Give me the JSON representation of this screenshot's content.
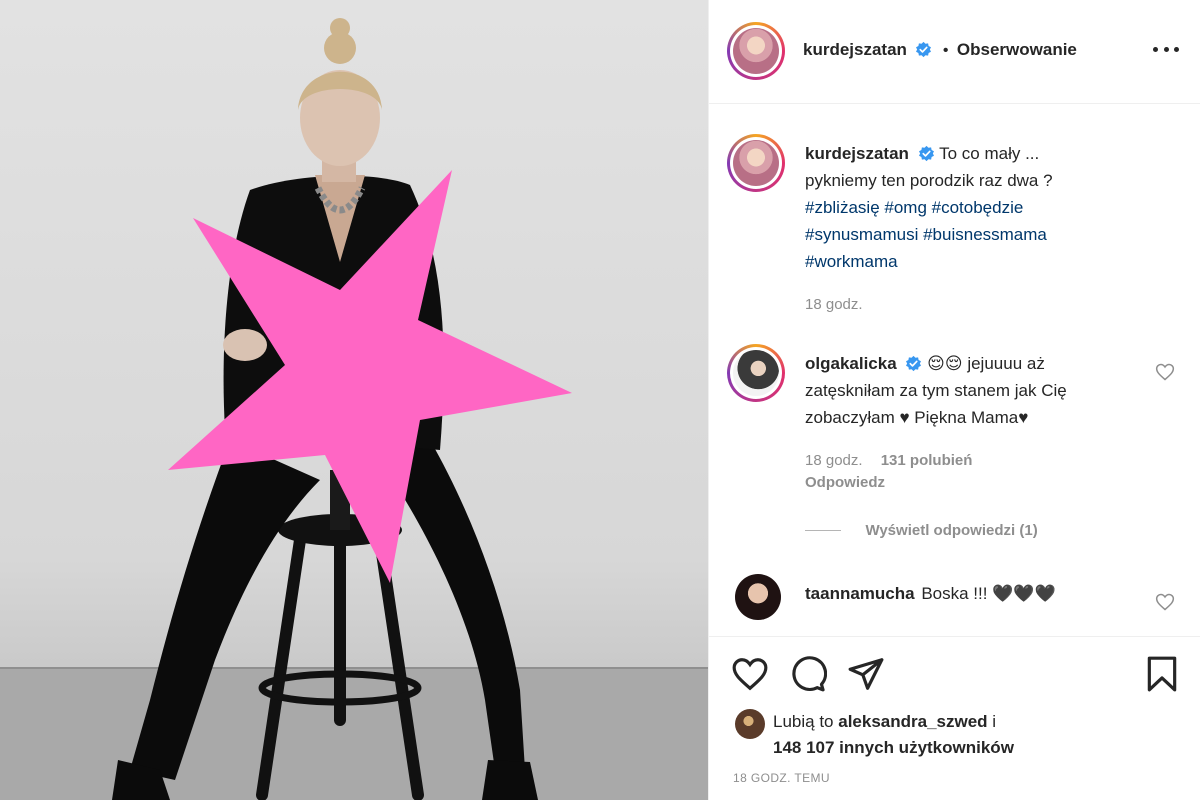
{
  "post": {
    "author": "kurdejszatan",
    "follow_label": "Obserwowanie",
    "separator": "•",
    "caption_line1": "To co mały ...",
    "caption_line2": "pykniemy ten porodzik raz dwa ?",
    "hashtags_line1": "#zbliżasię #omg #cotobędzie",
    "hashtags_line2": "#synusmamusi #buisnessmama",
    "hashtags_line3": "#workmama",
    "caption_time": "18 godz."
  },
  "comments": [
    {
      "user": "olgakalicka",
      "emoji": "😌😌",
      "line1": "jejuuuu aż",
      "line2": "zatęskniłam za tym stanem jak Cię",
      "line3": "zobaczyłam ♥ Piękna Mama♥",
      "time": "18 godz.",
      "likes": "131 polubień",
      "reply": "Odpowiedz",
      "view_replies": "Wyświetl odpowiedzi (1)"
    },
    {
      "user": "taannamucha",
      "text": "Boska !!! 🖤🖤🖤"
    }
  ],
  "likes": {
    "prefix": "Lubią to",
    "user": "aleksandra_szwed",
    "conj": "i",
    "count": "148 107 innych użytkowników"
  },
  "time_ago": "18 GODZ. TEMU",
  "colors": {
    "star": "#ff66c4",
    "verified": "#3897f0",
    "hashtag": "#00376b"
  },
  "icons": [
    "heart-icon",
    "comment-icon",
    "share-icon",
    "bookmark-icon",
    "more-icon",
    "verified-icon"
  ]
}
